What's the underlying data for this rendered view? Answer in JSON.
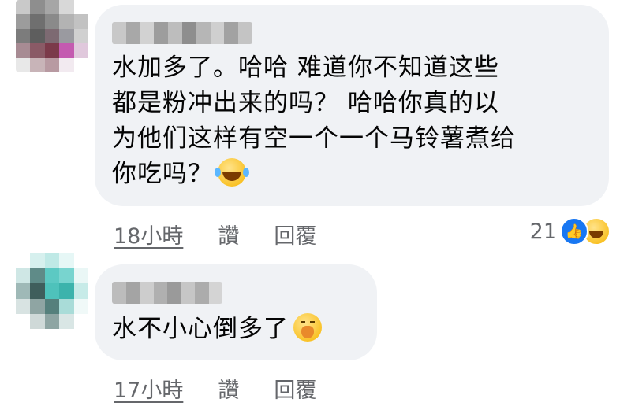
{
  "comments": [
    {
      "text_lines": [
        "水加多了。哈哈 难道你不知道这些",
        "都是粉冲出来的吗？ 哈哈你真的以",
        "为他们这样有空一个一个马铃薯煮给",
        "你吃吗？"
      ],
      "emoji_icon": "face-with-tears-of-joy",
      "time": "18小時",
      "like_label": "讚",
      "reply_label": "回覆",
      "reaction_count": "21",
      "reaction_icons": [
        "like-icon",
        "haha-icon"
      ]
    },
    {
      "text_lines": [
        "水不小心倒多了"
      ],
      "emoji_icon": "face-with-hand-over-mouth",
      "time": "17小時",
      "like_label": "讚",
      "reply_label": "回覆"
    }
  ],
  "colors": {
    "bubble_bg": "#f0f2f5",
    "meta_text": "#65676b",
    "body_text": "#050505",
    "like_blue": "#1877f2"
  }
}
